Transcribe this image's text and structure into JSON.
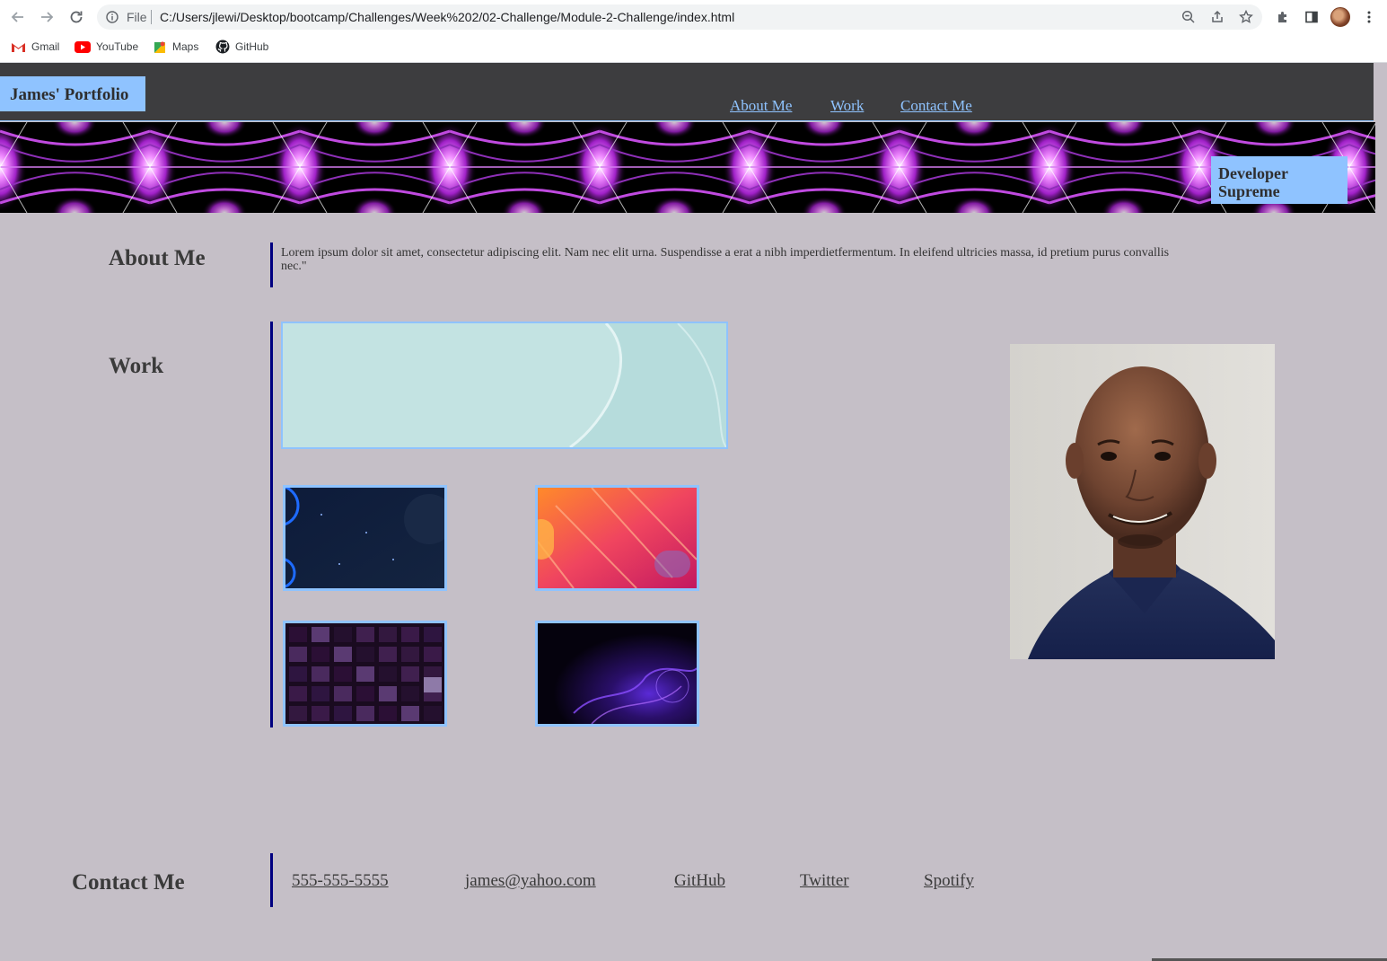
{
  "browser": {
    "file_label": "File",
    "url": "C:/Users/jlewi/Desktop/bootcamp/Challenges/Week%202/02-Challenge/Module-2-Challenge/index.html",
    "bookmarks": [
      {
        "label": "Gmail"
      },
      {
        "label": "YouTube"
      },
      {
        "label": "Maps"
      },
      {
        "label": "GitHub"
      }
    ]
  },
  "header": {
    "logo": "James' Portfolio",
    "nav": [
      {
        "label": "About Me"
      },
      {
        "label": "Work"
      },
      {
        "label": "Contact Me"
      }
    ]
  },
  "hero": {
    "badge": "Developer Supreme"
  },
  "about": {
    "title": "About Me",
    "text": "Lorem ipsum dolor sit amet, consectetur adipiscing elit. Nam nec elit urna. Suspendisse a erat a nibh imperdietfermentum. In eleifend ultricies massa, id pretium purus convallis nec.\""
  },
  "work": {
    "title": "Work"
  },
  "contact": {
    "title": "Contact Me",
    "links": [
      {
        "label": "555-555-5555"
      },
      {
        "label": "james@yahoo.com"
      },
      {
        "label": "GitHub"
      },
      {
        "label": "Twitter"
      },
      {
        "label": "Spotify"
      }
    ]
  },
  "colors": {
    "accent": "#8fc3ff",
    "header_bg": "#3d3d3f",
    "page_bg": "#c5bfc7",
    "rule": "#000080"
  }
}
